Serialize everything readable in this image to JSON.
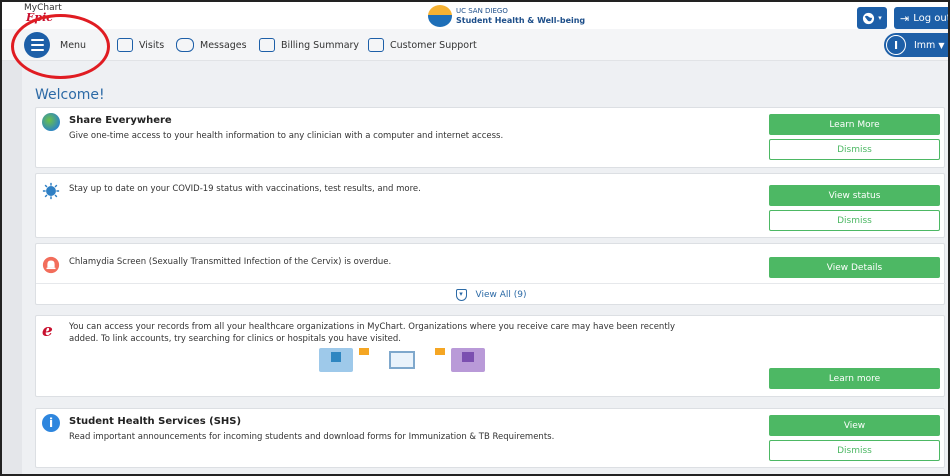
{
  "header": {
    "brand_my": "MyChart",
    "brand_epic": "Epic",
    "logo_line1": "UC SAN DIEGO",
    "logo_line2": "Student Health & Well-being",
    "logout_label": "Log out"
  },
  "nav": {
    "menu": "Menu",
    "visits": "Visits",
    "messages": "Messages",
    "billing": "Billing Summary",
    "support": "Customer Support",
    "user_initial": "I",
    "user_name": "Imm"
  },
  "main": {
    "welcome": "Welcome!",
    "cards": [
      {
        "title": "Share Everywhere",
        "text": "Give one-time access to your health information to any clinician with a computer and internet access.",
        "primary": "Learn More",
        "secondary": "Dismiss"
      },
      {
        "text": "Stay up to date on your COVID-19 status with vaccinations, test results, and more.",
        "primary": "View status",
        "secondary": "Dismiss"
      },
      {
        "text": "Chlamydia Screen (Sexually Transmitted Infection of the Cervix) is overdue.",
        "primary": "View Details"
      },
      {
        "text_line1": "You can access your records from all your healthcare organizations in MyChart. Organizations where you receive care may have been recently",
        "text_line2": "added. To link accounts, try searching for clinics or hospitals you have visited.",
        "primary": "Learn more"
      },
      {
        "title": "Student Health Services (SHS)",
        "text": "Read important announcements for incoming students and download forms for Immunization & TB Requirements.",
        "primary": "View",
        "secondary": "Dismiss"
      }
    ],
    "view_all": "View All (9)"
  }
}
